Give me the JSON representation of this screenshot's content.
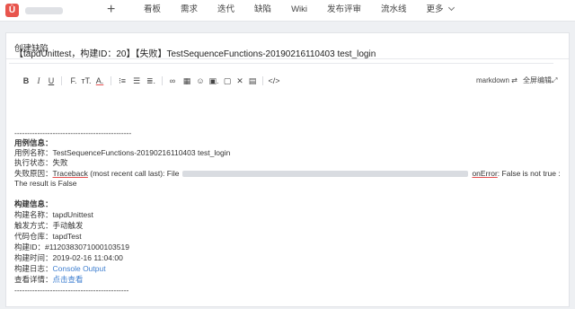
{
  "topbar": {
    "nav": [
      "看板",
      "需求",
      "迭代",
      "缺陷",
      "Wiki",
      "发布评审",
      "流水线",
      "更多"
    ]
  },
  "card": {
    "title": "创建缺陷"
  },
  "bug": {
    "title": "【tapdUnittest，构建ID：20】【失败】TestSequenceFunctions-20190216110403 test_login"
  },
  "toolbar": {
    "markdown_label": "markdown",
    "fullscreen_label": "全屏编辑"
  },
  "report": {
    "separator": "----------------------------------------------",
    "case_heading": "用例信息：",
    "case_name": "用例名称：TestSequenceFunctions-20190216110403 test_login",
    "exec_status": "执行状态：失败",
    "fail_prefix": "失败原因：",
    "fail_traceback": "Traceback",
    "fail_mid": " (most recent call last): File",
    "fail_error_tail": "onError",
    "fail_tail": ": False is not true :",
    "fail_line2": "The result is False",
    "build_heading": "构建信息：",
    "build_name": "构建名称：tapdUnittest",
    "trigger": "触发方式：手动触发",
    "repo": "代码仓库：tapdTest",
    "build_id": "构建ID：#1120383071000103519",
    "build_time": "构建时间：2019-02-16 11:04:00",
    "log_prefix": "构建日志：",
    "log_link": "Console Output",
    "detail_prefix": "查看详情：",
    "detail_link": "点击查看",
    "separator_end": "---------------------------------------------"
  }
}
